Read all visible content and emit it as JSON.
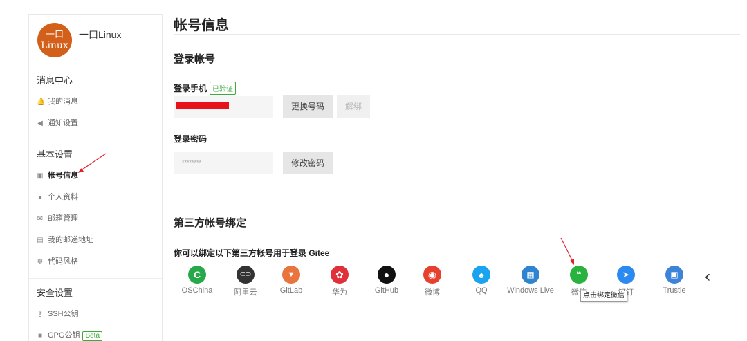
{
  "profile": {
    "avatar_line1": "一口",
    "avatar_line2": "Linux",
    "username": "一口Linux"
  },
  "sidebar": {
    "sections": [
      {
        "title": "消息中心",
        "items": [
          {
            "label": "我的消息",
            "icon": "bell-icon"
          },
          {
            "label": "通知设置",
            "icon": "speaker-icon"
          }
        ]
      },
      {
        "title": "基本设置",
        "items": [
          {
            "label": "帐号信息",
            "icon": "id-card-icon",
            "active": true
          },
          {
            "label": "个人资料",
            "icon": "user-icon"
          },
          {
            "label": "邮箱管理",
            "icon": "envelope-icon"
          },
          {
            "label": "我的邮递地址",
            "icon": "address-card-icon"
          },
          {
            "label": "代码风格",
            "icon": "palette-icon"
          }
        ]
      },
      {
        "title": "安全设置",
        "items": [
          {
            "label": "SSH公钥",
            "icon": "key-icon"
          },
          {
            "label": "GPG公钥",
            "icon": "lock-icon",
            "badge": "Beta"
          }
        ]
      }
    ]
  },
  "main": {
    "title": "帐号信息",
    "login_section": "登录帐号",
    "phone_label": "登录手机",
    "verified_badge": "已验证",
    "change_number_button": "更换号码",
    "unbind_button": "解绑",
    "password_label": "登录密码",
    "password_mask": "********",
    "change_password_button": "修改密码",
    "third_party_title": "第三方帐号绑定",
    "third_party_desc": "你可以绑定以下第三方帐号用于登录 Gitee",
    "providers": [
      {
        "name": "OSChina",
        "glyph": "C",
        "color": "#27a84a"
      },
      {
        "name": "阿里云",
        "glyph": "⊂⊃",
        "color": "#333333"
      },
      {
        "name": "GitLab",
        "glyph": "▼",
        "color": "#e9743e"
      },
      {
        "name": "华为",
        "glyph": "✿",
        "color": "#e0303a"
      },
      {
        "name": "GitHub",
        "glyph": "●",
        "color": "#111111"
      },
      {
        "name": "微博",
        "glyph": "◉",
        "color": "#e6402e"
      },
      {
        "name": "QQ",
        "glyph": "♠",
        "color": "#1aa3ee"
      },
      {
        "name": "Windows Live",
        "glyph": "▦",
        "color": "#2f84d0"
      },
      {
        "name": "微信",
        "glyph": "❝",
        "color": "#29b33e"
      },
      {
        "name": "钉钉",
        "glyph": "➤",
        "color": "#2a8af0"
      },
      {
        "name": "Trustie",
        "glyph": "▣",
        "color": "#3d83d8"
      }
    ],
    "tooltip": "点击绑定微信",
    "next_icon": "chevron-left-icon"
  },
  "colors": {
    "accent_green": "#3aaa3a",
    "annotation_red": "#e0202a"
  }
}
